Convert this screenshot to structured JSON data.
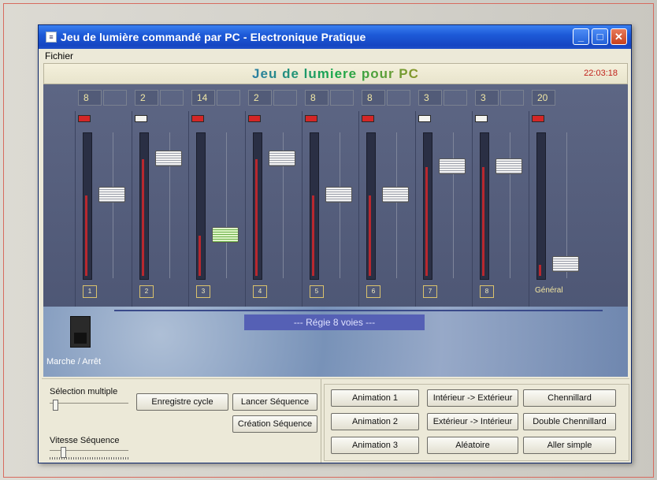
{
  "window": {
    "title": "Jeu de lumière commandé par PC - Electronique Pratique",
    "app_icon": "document-icon"
  },
  "menu": {
    "file": "Fichier"
  },
  "header": {
    "app_title": "Jeu de lumiere pour PC",
    "clock": "22:03:18"
  },
  "channels": [
    {
      "value": "8",
      "led": "on",
      "label": "1",
      "level": 0.58
    },
    {
      "value": "2",
      "led": "off",
      "label": "2",
      "level": 0.86
    },
    {
      "value": "14",
      "led": "on",
      "label": "3",
      "level": 0.27,
      "selected": true
    },
    {
      "value": "2",
      "led": "on",
      "label": "4",
      "level": 0.86
    },
    {
      "value": "8",
      "led": "on",
      "label": "5",
      "level": 0.58
    },
    {
      "value": "8",
      "led": "on",
      "label": "6",
      "level": 0.58
    },
    {
      "value": "3",
      "led": "off",
      "label": "7",
      "level": 0.8
    },
    {
      "value": "3",
      "led": "off",
      "label": "8",
      "level": 0.8
    }
  ],
  "general": {
    "value": "20",
    "label": "Général",
    "level": 0.05
  },
  "regie": "--- Régie 8 voies ---",
  "power_switch": {
    "label": "Marche / Arrêt"
  },
  "controls": {
    "selection_multiple": "Sélection multiple",
    "vitesse_sequence": "Vitesse Séquence",
    "enregistre_cycle": "Enregistre cycle",
    "lancer_sequence": "Lancer Séquence",
    "creation_sequence": "Création Séquence"
  },
  "animations": [
    [
      "Animation 1",
      "Intérieur -> Extérieur",
      "Chennillard"
    ],
    [
      "Animation 2",
      "Extérieur -> Intérieur",
      "Double Chennillard"
    ],
    [
      "Animation 3",
      "Aléatoire",
      "Aller simple"
    ]
  ]
}
